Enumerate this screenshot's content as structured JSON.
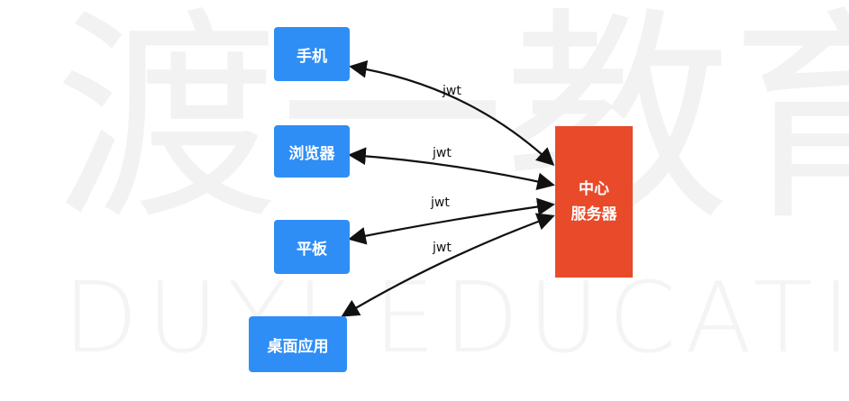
{
  "watermark": {
    "cn": "渡一教育",
    "en": "DUYI EDUCATION"
  },
  "colors": {
    "client": "#2F8EF6",
    "server": "#E84A2A",
    "edge": "#111111"
  },
  "clients": [
    {
      "id": "phone",
      "label": "手机"
    },
    {
      "id": "browser",
      "label": "浏览器"
    },
    {
      "id": "tablet",
      "label": "平板"
    },
    {
      "id": "desktop",
      "label": "桌面应用"
    }
  ],
  "server": {
    "line1": "中心",
    "line2": "服务器"
  },
  "edges": [
    {
      "from": "phone",
      "label": "jwt"
    },
    {
      "from": "browser",
      "label": "jwt"
    },
    {
      "from": "tablet",
      "label": "jwt"
    },
    {
      "from": "desktop",
      "label": "jwt"
    }
  ]
}
